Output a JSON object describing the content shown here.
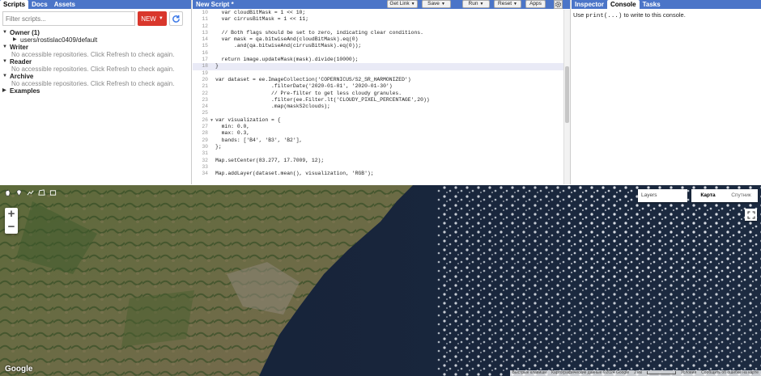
{
  "left_panel": {
    "tabs": [
      "Scripts",
      "Docs",
      "Assets"
    ],
    "search_placeholder": "Filter scripts...",
    "new_label": "NEW",
    "tree": {
      "owner": {
        "label": "Owner (1)",
        "repo": "users/rostislac0409/default"
      },
      "writer": {
        "label": "Writer",
        "note": "No accessible repositories. Click Refresh to check again."
      },
      "reader": {
        "label": "Reader",
        "note": "No accessible repositories. Click Refresh to check again."
      },
      "archive": {
        "label": "Archive",
        "note": "No accessible repositories. Click Refresh to check again."
      },
      "examples": {
        "label": "Examples"
      }
    }
  },
  "editor": {
    "title": "New Script *",
    "buttons": {
      "get_link": "Get Link",
      "save": "Save",
      "run": "Run",
      "reset": "Reset",
      "apps": "Apps"
    },
    "lines": [
      {
        "n": "10",
        "t": "  var cloudBitMask = 1 << 10;"
      },
      {
        "n": "11",
        "t": "  var cirrusBitMask = 1 << 11;"
      },
      {
        "n": "12",
        "t": ""
      },
      {
        "n": "13",
        "t": "  // Both flags should be set to zero, indicating clear conditions."
      },
      {
        "n": "14",
        "t": "  var mask = qa.bitwiseAnd(cloudBitMask).eq(0)"
      },
      {
        "n": "15",
        "t": "      .and(qa.bitwiseAnd(cirrusBitMask).eq(0));"
      },
      {
        "n": "16",
        "t": ""
      },
      {
        "n": "17",
        "t": "  return image.updateMask(mask).divide(10000);"
      },
      {
        "n": "18",
        "t": "}"
      },
      {
        "n": "19",
        "t": ""
      },
      {
        "n": "20",
        "t": "var dataset = ee.ImageCollection('COPERNICUS/S2_SR_HARMONIZED')"
      },
      {
        "n": "21",
        "t": "                  .filterDate('2020-01-01', '2020-01-30')"
      },
      {
        "n": "22",
        "t": "                  // Pre-filter to get less cloudy granules."
      },
      {
        "n": "23",
        "t": "                  .filter(ee.Filter.lt('CLOUDY_PIXEL_PERCENTAGE',20))"
      },
      {
        "n": "24",
        "t": "                  .map(maskS2clouds);"
      },
      {
        "n": "25",
        "t": ""
      },
      {
        "n": "26",
        "t": "var visualization = {"
      },
      {
        "n": "27",
        "t": "  min: 0.0,"
      },
      {
        "n": "28",
        "t": "  max: 0.3,"
      },
      {
        "n": "29",
        "t": "  bands: ['B4', 'B3', 'B2'],"
      },
      {
        "n": "30",
        "t": "};"
      },
      {
        "n": "31",
        "t": ""
      },
      {
        "n": "32",
        "t": "Map.setCenter(83.277, 17.7009, 12);"
      },
      {
        "n": "33",
        "t": ""
      },
      {
        "n": "34",
        "t": "Map.addLayer(dataset.mean(), visualization, 'RGB');"
      }
    ]
  },
  "right_panel": {
    "tabs": [
      "Inspector",
      "Console",
      "Tasks"
    ],
    "console_prefix": "Use ",
    "console_code": "print(...)",
    "console_suffix": " to write to this console."
  },
  "map": {
    "layers_label": "Layers",
    "map_type": [
      "Карта",
      "Спутник"
    ],
    "logo": "Google",
    "attribution": [
      "Быстрые клавиши",
      "Картографические данные ©2024 Google",
      "2 км",
      "Условия",
      "Сообщить об ошибке на карте"
    ]
  }
}
